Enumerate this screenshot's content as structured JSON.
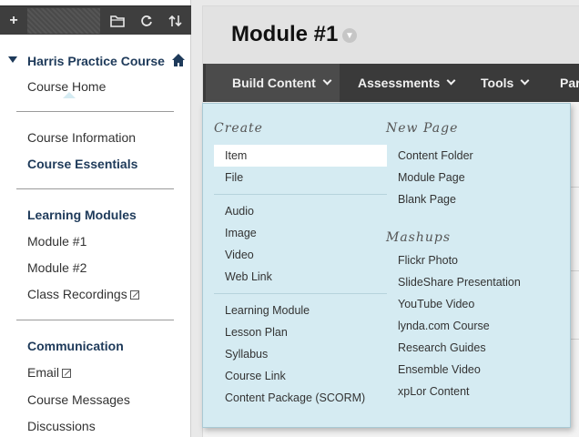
{
  "sidebar": {
    "toolbar": {
      "add_icon": "plus-icon",
      "folder_icon": "folder-icon",
      "refresh_icon": "refresh-icon",
      "sort_icon": "sort-icon"
    },
    "course_title": "Harris Practice Course",
    "course_home": "Course Home",
    "course_information": "Course Information",
    "course_essentials": "Course Essentials",
    "learning_modules_heading": "Learning Modules",
    "module_1": "Module #1",
    "module_2": "Module #2",
    "class_recordings": "Class Recordings",
    "communication_heading": "Communication",
    "email": "Email",
    "course_messages": "Course Messages",
    "discussions": "Discussions"
  },
  "main": {
    "page_title": "Module #1",
    "actionbar": {
      "build_content": "Build Content",
      "assessments": "Assessments",
      "tools": "Tools",
      "partial": "Par"
    }
  },
  "menu": {
    "create_heading": "Create",
    "create_group1": [
      "Item",
      "File"
    ],
    "create_group2": [
      "Audio",
      "Image",
      "Video",
      "Web Link"
    ],
    "create_group3": [
      "Learning Module",
      "Lesson Plan",
      "Syllabus",
      "Course Link",
      "Content Package (SCORM)"
    ],
    "new_page_heading": "New Page",
    "new_page_items": [
      "Content Folder",
      "Module Page",
      "Blank Page"
    ],
    "mashups_heading": "Mashups",
    "mashups_items": [
      "Flickr Photo",
      "SlideShare Presentation",
      "YouTube Video",
      "lynda.com Course",
      "Research Guides",
      "Ensemble Video",
      "xpLor Content"
    ]
  },
  "colors": {
    "accent": "#1e3a5a",
    "actionbar": "#3a3a3a",
    "menu_bg": "#d5ebf2"
  }
}
